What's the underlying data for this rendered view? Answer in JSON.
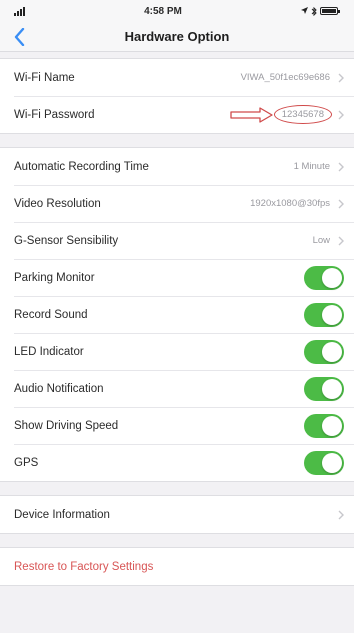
{
  "status_bar": {
    "time": "4:58 PM"
  },
  "nav": {
    "title": "Hardware Option"
  },
  "wifi": {
    "name_label": "Wi-Fi Name",
    "name_value": "VIWA_50f1ec69e686",
    "password_label": "Wi-Fi Password",
    "password_value": "12345678"
  },
  "settings": {
    "recording_label": "Automatic Recording Time",
    "recording_value": "1 Minute",
    "resolution_label": "Video Resolution",
    "resolution_value": "1920x1080@30fps",
    "gsensor_label": "G-Sensor Sensibility",
    "gsensor_value": "Low"
  },
  "toggles": [
    {
      "label": "Parking Monitor",
      "on": true
    },
    {
      "label": "Record Sound",
      "on": true
    },
    {
      "label": "LED Indicator",
      "on": true
    },
    {
      "label": "Audio Notification",
      "on": true
    },
    {
      "label": "Show Driving Speed",
      "on": true
    },
    {
      "label": "GPS",
      "on": true
    }
  ],
  "device": {
    "info_label": "Device Information"
  },
  "restore": {
    "label": "Restore to Factory Settings"
  },
  "colors": {
    "toggle_on": "#4cbb46",
    "danger": "#d85555",
    "annotation": "#d04a4a"
  },
  "icons": [
    "back-chevron-icon",
    "chevron-right-icon",
    "arrow-annotation-icon"
  ]
}
